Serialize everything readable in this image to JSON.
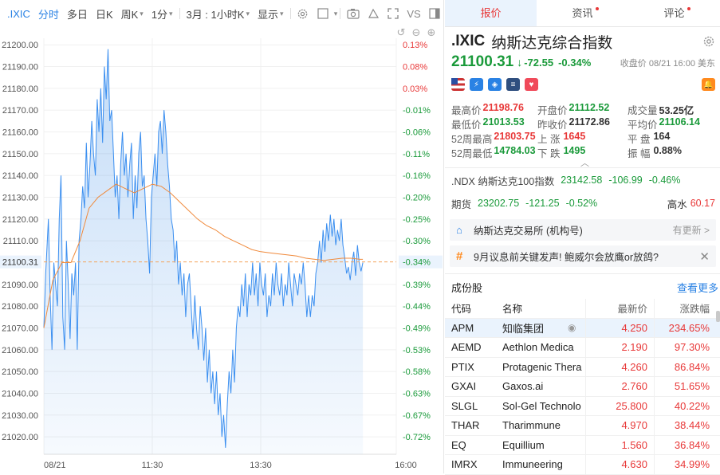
{
  "toolbar": {
    "symbol": ".IXIC",
    "tabs": [
      "分时",
      "多日",
      "日K",
      "周K",
      "1分"
    ],
    "range_select": "3月 : 1小时K",
    "display_select": "显示",
    "vs_label": "VS"
  },
  "right_tabs": [
    "报价",
    "资讯",
    "评论"
  ],
  "header": {
    "symbol": ".IXIC",
    "name": "纳斯达克综合指数",
    "price": "21100.31",
    "change": "-72.55",
    "change_pct": "-0.34%",
    "close_time": "收盘价 08/21 16:00 美东"
  },
  "stats": {
    "high_label": "最高价",
    "high": "21198.76",
    "open_label": "开盘价",
    "open": "21112.52",
    "volume_label": "成交量",
    "volume": "53.25亿",
    "low_label": "最低价",
    "low": "21013.53",
    "prev_close_label": "昨收价",
    "prev_close": "21172.86",
    "avg_label": "平均价",
    "avg": "21106.14",
    "w52_high_label": "52周最高",
    "w52_high": "21803.75",
    "up_label": "上 涨",
    "up": "1645",
    "flat_label": "平 盘",
    "flat": "164",
    "w52_low_label": "52周最低",
    "w52_low": "14784.03",
    "down_label": "下 跌",
    "down": "1495",
    "amp_label": "振 幅",
    "amp": "0.88%"
  },
  "ndx": {
    "name": ".NDX 纳斯达克100指数",
    "price": "23142.58",
    "change": "-106.99",
    "change_pct": "-0.46%"
  },
  "futures": {
    "label": "期货",
    "price": "23202.75",
    "change": "-121.25",
    "change_pct": "-0.52%",
    "premium_label": "高水",
    "premium": "60.17"
  },
  "exchange_card": {
    "text": "纳斯达克交易所 (机构号)",
    "right": "有更新 >"
  },
  "news_card": {
    "text": "9月议息前关键发声! 鲍威尔会放鹰or放鸽?"
  },
  "constituents": {
    "title": "成份股",
    "see_more": "查看更多",
    "headers": {
      "code": "代码",
      "name": "名称",
      "price": "最新价",
      "pct": "涨跌幅"
    },
    "rows": [
      {
        "code": "APM",
        "name": "知临集团",
        "price": "4.250",
        "pct": "234.65%"
      },
      {
        "code": "AEMD",
        "name": "Aethlon Medica",
        "price": "2.190",
        "pct": "97.30%"
      },
      {
        "code": "PTIX",
        "name": "Protagenic Thera",
        "price": "4.260",
        "pct": "86.84%"
      },
      {
        "code": "GXAI",
        "name": "Gaxos.ai",
        "price": "2.760",
        "pct": "51.65%"
      },
      {
        "code": "SLGL",
        "name": "Sol-Gel Technolo",
        "price": "25.800",
        "pct": "40.22%"
      },
      {
        "code": "THAR",
        "name": "Tharimmune",
        "price": "4.970",
        "pct": "38.44%"
      },
      {
        "code": "EQ",
        "name": "Equillium",
        "price": "1.560",
        "pct": "36.84%"
      },
      {
        "code": "IMRX",
        "name": "Immuneering",
        "price": "4.630",
        "pct": "34.99%"
      }
    ]
  },
  "chart_data": {
    "type": "line",
    "prev_close": 21172.86,
    "last": 21100.31,
    "y_ticks": [
      21200,
      21190,
      21180,
      21170,
      21160,
      21150,
      21140,
      21130,
      21120,
      21110,
      21100.31,
      21090,
      21080,
      21070,
      21060,
      21050,
      21040,
      21030,
      21020
    ],
    "y_tick_labels": [
      "21200.00",
      "21190.00",
      "21180.00",
      "21170.00",
      "21160.00",
      "21150.00",
      "21140.00",
      "21130.00",
      "21120.00",
      "21110.00",
      "21100.31",
      "21090.00",
      "21080.00",
      "21070.00",
      "21060.00",
      "21050.00",
      "21040.00",
      "21030.00",
      "21020.00"
    ],
    "pct_labels": [
      "0.13%",
      "0.08%",
      "0.03%",
      "-0.01%",
      "-0.06%",
      "-0.11%",
      "-0.16%",
      "-0.20%",
      "-0.25%",
      "-0.30%",
      "-0.34%",
      "-0.39%",
      "-0.44%",
      "-0.49%",
      "-0.53%",
      "-0.58%",
      "-0.63%",
      "-0.67%",
      "-0.72%"
    ],
    "x_labels": [
      "08/21",
      "11:30",
      "13:30",
      "16:00"
    ],
    "x_label_minutes": [
      0,
      120,
      240,
      390
    ],
    "ylim": [
      21012,
      21203
    ],
    "series": [
      {
        "name": "price",
        "points": [
          [
            0,
            21070
          ],
          [
            2,
            21095
          ],
          [
            5,
            21120
          ],
          [
            7,
            21085
          ],
          [
            9,
            21060
          ],
          [
            11,
            21100
          ],
          [
            13,
            21090
          ],
          [
            15,
            21080
          ],
          [
            17,
            21120
          ],
          [
            19,
            21140
          ],
          [
            21,
            21075
          ],
          [
            23,
            21060
          ],
          [
            25,
            21110
          ],
          [
            27,
            21090
          ],
          [
            29,
            21065
          ],
          [
            31,
            21095
          ],
          [
            33,
            21085
          ],
          [
            35,
            21100
          ],
          [
            37,
            21060
          ],
          [
            39,
            21110
          ],
          [
            41,
            21120
          ],
          [
            43,
            21135
          ],
          [
            45,
            21125
          ],
          [
            47,
            21155
          ],
          [
            49,
            21130
          ],
          [
            51,
            21145
          ],
          [
            53,
            21165
          ],
          [
            55,
            21150
          ],
          [
            57,
            21140
          ],
          [
            59,
            21175
          ],
          [
            61,
            21160
          ],
          [
            63,
            21180
          ],
          [
            65,
            21155
          ],
          [
            67,
            21190
          ],
          [
            69,
            21175
          ],
          [
            71,
            21198
          ],
          [
            73,
            21165
          ],
          [
            75,
            21170
          ],
          [
            77,
            21150
          ],
          [
            79,
            21130
          ],
          [
            81,
            21140
          ],
          [
            83,
            21120
          ],
          [
            85,
            21145
          ],
          [
            87,
            21160
          ],
          [
            89,
            21140
          ],
          [
            91,
            21150
          ],
          [
            93,
            21130
          ],
          [
            95,
            21145
          ],
          [
            97,
            21155
          ],
          [
            99,
            21120
          ],
          [
            101,
            21140
          ],
          [
            103,
            21125
          ],
          [
            105,
            21150
          ],
          [
            107,
            21160
          ],
          [
            109,
            21135
          ],
          [
            111,
            21140
          ],
          [
            113,
            21120
          ],
          [
            115,
            21110
          ],
          [
            117,
            21095
          ],
          [
            119,
            21130
          ],
          [
            121,
            21140
          ],
          [
            123,
            21150
          ],
          [
            125,
            21135
          ],
          [
            127,
            21160
          ],
          [
            129,
            21165
          ],
          [
            131,
            21150
          ],
          [
            133,
            21170
          ],
          [
            135,
            21160
          ],
          [
            137,
            21145
          ],
          [
            139,
            21135
          ],
          [
            141,
            21120
          ],
          [
            143,
            21115
          ],
          [
            145,
            21100
          ],
          [
            147,
            21110
          ],
          [
            149,
            21090
          ],
          [
            151,
            21100
          ],
          [
            153,
            21085
          ],
          [
            155,
            21095
          ],
          [
            157,
            21075
          ],
          [
            159,
            21090
          ],
          [
            161,
            21095
          ],
          [
            163,
            21080
          ],
          [
            165,
            21065
          ],
          [
            167,
            21085
          ],
          [
            169,
            21070
          ],
          [
            171,
            21060
          ],
          [
            173,
            21080
          ],
          [
            175,
            21070
          ],
          [
            177,
            21055
          ],
          [
            179,
            21070
          ],
          [
            181,
            21045
          ],
          [
            183,
            21060
          ],
          [
            185,
            21040
          ],
          [
            187,
            21050
          ],
          [
            189,
            21035
          ],
          [
            191,
            21050
          ],
          [
            193,
            21030
          ],
          [
            195,
            21040
          ],
          [
            197,
            21020
          ],
          [
            199,
            21030
          ],
          [
            201,
            21015
          ],
          [
            203,
            21035
          ],
          [
            205,
            21050
          ],
          [
            207,
            21040
          ],
          [
            209,
            21060
          ],
          [
            211,
            21045
          ],
          [
            213,
            21070
          ],
          [
            215,
            21080
          ],
          [
            217,
            21075
          ],
          [
            219,
            21090
          ],
          [
            221,
            21080
          ],
          [
            223,
            21095
          ],
          [
            225,
            21075
          ],
          [
            227,
            21090
          ],
          [
            229,
            21085
          ],
          [
            231,
            21100
          ],
          [
            233,
            21085
          ],
          [
            235,
            21095
          ],
          [
            237,
            21080
          ],
          [
            239,
            21100
          ],
          [
            241,
            21090
          ],
          [
            243,
            21085
          ],
          [
            245,
            21095
          ],
          [
            247,
            21075
          ],
          [
            249,
            21085
          ],
          [
            251,
            21080
          ],
          [
            253,
            21095
          ],
          [
            255,
            21085
          ],
          [
            257,
            21100
          ],
          [
            259,
            21090
          ],
          [
            261,
            21085
          ],
          [
            263,
            21095
          ],
          [
            265,
            21080
          ],
          [
            267,
            21090
          ],
          [
            269,
            21085
          ],
          [
            271,
            21100
          ],
          [
            273,
            21090
          ],
          [
            275,
            21080
          ],
          [
            277,
            21095
          ],
          [
            279,
            21090
          ],
          [
            281,
            21085
          ],
          [
            283,
            21095
          ],
          [
            285,
            21090
          ],
          [
            287,
            21100
          ],
          [
            289,
            21090
          ],
          [
            291,
            21075
          ],
          [
            293,
            21085
          ],
          [
            295,
            21075
          ],
          [
            297,
            21085
          ],
          [
            299,
            21080
          ],
          [
            301,
            21095
          ],
          [
            303,
            21100
          ],
          [
            305,
            21110
          ],
          [
            307,
            21100
          ],
          [
            309,
            21115
          ],
          [
            311,
            21105
          ],
          [
            313,
            21118
          ],
          [
            315,
            21110
          ],
          [
            317,
            21122
          ],
          [
            319,
            21112
          ],
          [
            321,
            21120
          ],
          [
            323,
            21108
          ],
          [
            325,
            21115
          ],
          [
            327,
            21110
          ],
          [
            329,
            21120
          ],
          [
            331,
            21108
          ],
          [
            333,
            21102
          ],
          [
            335,
            21095
          ],
          [
            337,
            21098
          ],
          [
            339,
            21092
          ],
          [
            341,
            21100
          ],
          [
            343,
            21105
          ],
          [
            345,
            21094
          ],
          [
            347,
            21108
          ],
          [
            349,
            21100
          ],
          [
            351,
            21096
          ],
          [
            353,
            21100
          ]
        ]
      },
      {
        "name": "avg",
        "points": [
          [
            0,
            21070
          ],
          [
            10,
            21092
          ],
          [
            20,
            21100
          ],
          [
            30,
            21100
          ],
          [
            40,
            21110
          ],
          [
            50,
            21125
          ],
          [
            60,
            21130
          ],
          [
            70,
            21133
          ],
          [
            80,
            21136
          ],
          [
            90,
            21134
          ],
          [
            100,
            21132
          ],
          [
            110,
            21134
          ],
          [
            120,
            21136
          ],
          [
            130,
            21135
          ],
          [
            140,
            21132
          ],
          [
            150,
            21128
          ],
          [
            160,
            21124
          ],
          [
            170,
            21120
          ],
          [
            180,
            21117
          ],
          [
            190,
            21115
          ],
          [
            200,
            21112
          ],
          [
            210,
            21110
          ],
          [
            220,
            21108
          ],
          [
            230,
            21106
          ],
          [
            240,
            21105
          ],
          [
            250,
            21104.5
          ],
          [
            260,
            21104
          ],
          [
            270,
            21103.5
          ],
          [
            280,
            21103
          ],
          [
            290,
            21102
          ],
          [
            300,
            21101.5
          ],
          [
            310,
            21101
          ],
          [
            320,
            21101.5
          ],
          [
            330,
            21102
          ],
          [
            340,
            21102
          ],
          [
            350,
            21101.5
          ],
          [
            353,
            21101.5
          ]
        ]
      }
    ]
  }
}
